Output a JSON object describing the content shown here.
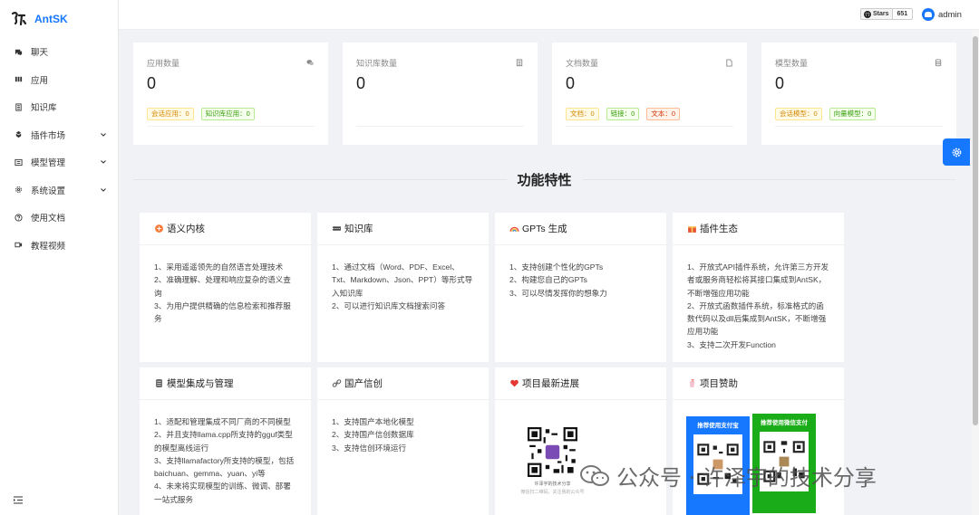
{
  "app": {
    "name": "AntSK"
  },
  "sidebar": {
    "items": [
      {
        "label": "聊天",
        "icon": "chat-icon",
        "expandable": false
      },
      {
        "label": "应用",
        "icon": "app-icon",
        "expandable": false
      },
      {
        "label": "知识库",
        "icon": "book-icon",
        "expandable": false
      },
      {
        "label": "插件市场",
        "icon": "plugin-icon",
        "expandable": true
      },
      {
        "label": "模型管理",
        "icon": "model-icon",
        "expandable": true
      },
      {
        "label": "系统设置",
        "icon": "gear-icon",
        "expandable": true
      },
      {
        "label": "使用文档",
        "icon": "question-icon",
        "expandable": false
      },
      {
        "label": "教程视频",
        "icon": "video-icon",
        "expandable": false
      }
    ],
    "collapse_icon": "menu-fold-icon"
  },
  "header": {
    "github_label": "Stars",
    "github_count": "651",
    "user_name": "admin"
  },
  "stats": [
    {
      "title": "应用数量",
      "value": "0",
      "icon": "wechat-icon",
      "tags": [
        {
          "text": "会话应用：0",
          "color": "orange"
        },
        {
          "text": "知识库应用：0",
          "color": "green"
        }
      ]
    },
    {
      "title": "知识库数量",
      "value": "0",
      "icon": "doc-list-icon",
      "tags": []
    },
    {
      "title": "文档数量",
      "value": "0",
      "icon": "file-icon",
      "tags": [
        {
          "text": "文档：0",
          "color": "orange"
        },
        {
          "text": "链接：0",
          "color": "green"
        },
        {
          "text": "文本：0",
          "color": "volcano"
        }
      ]
    },
    {
      "title": "模型数量",
      "value": "0",
      "icon": "database-icon",
      "tags": [
        {
          "text": "会话模型：0",
          "color": "orange"
        },
        {
          "text": "向量模型：0",
          "color": "green"
        }
      ]
    }
  ],
  "features_title": "功能特性",
  "features": [
    {
      "title": "语义内核",
      "icon": "sparkle-icon",
      "lines": [
        "1、采用遥遥领先的自然语言处理技术",
        "2、准确理解、处理和响应复杂的语义查询",
        "3、为用户提供精确的信息检索和推荐服务"
      ]
    },
    {
      "title": "知识库",
      "icon": "knowledge-icon",
      "lines": [
        "1、通过文档（Word、PDF、Excel、Txt、Markdown、Json、PPT）等形式导入知识库",
        "2、可以进行知识库文档搜索问答"
      ]
    },
    {
      "title": "GPTs 生成",
      "icon": "rainbow-icon",
      "lines": [
        "1、支持创建个性化的GPTs",
        "2、构建您自己的GPTs",
        "3、可以尽情发挥你的想象力"
      ]
    },
    {
      "title": "插件生态",
      "icon": "gift-icon",
      "lines": [
        "1、开放式API插件系统，允许第三方开发者或服务商轻松将其接口集成到AntSK，不断增强应用功能",
        "2、开放式函数插件系统，标准格式的函数代码以及dll后集成到AntSK，不断增强应用功能",
        "3、支持二次开发Function"
      ]
    },
    {
      "title": "模型集成与管理",
      "icon": "server-icon",
      "lines": [
        "1、适配和管理集成不同厂商的不同模型",
        "2、并且支持llama.cpp所支持的gguf类型的模型离线运行",
        "3、支持llamafactory所支持的模型，包括baichuan、gemma、yuan、yi等",
        "4、未来将实现模型的训练、微调、部署一站式服务"
      ]
    },
    {
      "title": "国产信创",
      "icon": "link-icon",
      "lines": [
        "1、支持国产本地化模型",
        "2、支持国产信创数据库",
        "3、支持信创环境运行"
      ]
    },
    {
      "title": "项目最新进展",
      "icon": "heart-icon",
      "lines": []
    },
    {
      "title": "项目赞助",
      "icon": "cup-icon",
      "lines": []
    }
  ],
  "progress_qr": {
    "caption": "许泽宇的技术分享",
    "sub": "微信扫二维码，关注我的公众号"
  },
  "sponsor": {
    "alipay_label": "推荐使用支付宝",
    "wechat_label": "推荐使用微信支付"
  },
  "watermark": {
    "text": "公众号 · 许泽宇的技术分享"
  },
  "colors": {
    "primary": "#1677ff",
    "alipay": "#1677ff",
    "wechat": "#1aad19"
  }
}
